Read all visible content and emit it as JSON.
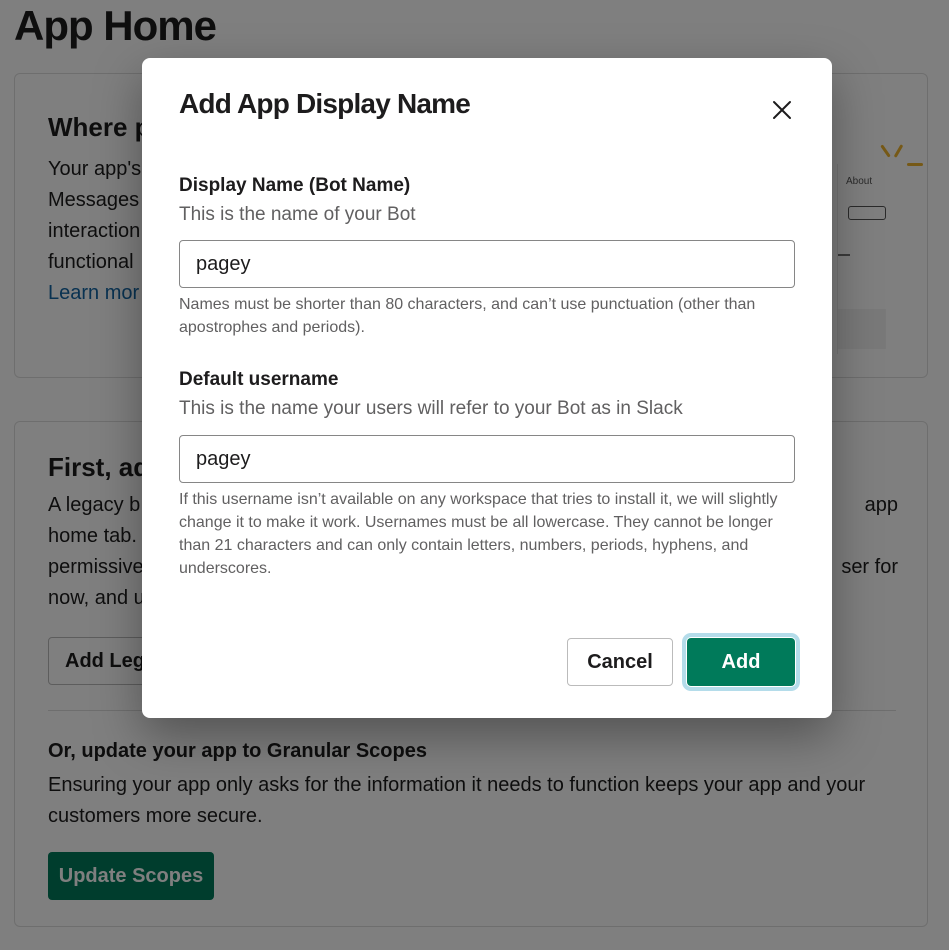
{
  "page": {
    "title": "App Home"
  },
  "background": {
    "card1": {
      "heading": "Where p",
      "text_lines": [
        "Your app's",
        "Messages",
        "interaction",
        "functional"
      ],
      "link": "Learn mor",
      "illustration_label": "About"
    },
    "card2": {
      "heading": "First, ad",
      "text_lines": [
        "A legacy b",
        "home tab.",
        "permissive",
        "now, and u"
      ],
      "text_right_lines": [
        "app",
        "",
        "ser for",
        ""
      ],
      "legacy_button_label": "Add Lega",
      "sub_heading": "Or, update your app to Granular Scopes",
      "sub_text": "Ensuring your app only asks for the information it needs to function keeps your app and your customers more secure.",
      "scopes_button_label": "Update Scopes"
    }
  },
  "modal": {
    "title": "Add App Display Name",
    "close_icon": "close-icon",
    "display_name": {
      "label": "Display Name (Bot Name)",
      "help": "This is the name of your Bot",
      "value": "pagey",
      "hint": "Names must be shorter than 80 characters, and can’t use punctuation (other than apostrophes and periods)."
    },
    "username": {
      "label": "Default username",
      "help": "This is the name your users will refer to your Bot as in Slack",
      "value": "pagey",
      "hint": "If this username isn’t available on any workspace that tries to install it, we will slightly change it to make it work. Usernames must be all lowercase. They cannot be longer than 21 characters and can only contain letters, numbers, periods, hyphens, and underscores."
    },
    "cancel_label": "Cancel",
    "add_label": "Add"
  },
  "colors": {
    "primary": "#007a5a",
    "link": "#1264a3",
    "focus_ring": "#b4dcea",
    "overlay": "rgba(0,0,0,0.5)"
  }
}
